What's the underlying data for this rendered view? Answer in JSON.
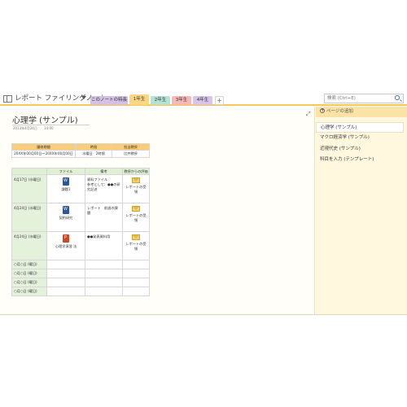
{
  "window": {
    "notebook_title": "レポート ファイリングノート"
  },
  "tabs": [
    {
      "label": "このノートの特長",
      "color": "#d5c0e6"
    },
    {
      "label": "1年生",
      "color": "#fbd784"
    },
    {
      "label": "2年生",
      "color": "#b4e3d6"
    },
    {
      "label": "3年生",
      "color": "#f7b9b6"
    },
    {
      "label": "4年生",
      "color": "#d8c3ea"
    },
    {
      "label": "+",
      "color": "#fafafa"
    }
  ],
  "search": {
    "placeholder": "検索 (Ctrl+E)"
  },
  "page": {
    "title": "心理学 (サンプル)",
    "date": "2013年4月24日",
    "time": "14:00",
    "info_table": {
      "headers": [
        "履修期間",
        "時限",
        "担当教授"
      ],
      "row": [
        "20XX年00月00日〜20XX年00月00日",
        "水曜日　2時限",
        "比井教授"
      ]
    },
    "report_table": {
      "headers": [
        "",
        "ファイル",
        "備考",
        "教授からの評価"
      ],
      "rows": [
        {
          "date": "4月17日 (水曜日)",
          "file": "課題1",
          "file_icon": "word-doc-icon",
          "note": "資料ファイル\n参考として：●●の研究記述",
          "eval": "レポートの受領",
          "eval_icon": "mail-icon"
        },
        {
          "date": "4月24日 (水曜日)",
          "file": "契約研究",
          "file_icon": "word-doc-icon",
          "note": "レポート　前週の課題",
          "eval": "レポートの受領",
          "eval_icon": "mail-icon"
        },
        {
          "date": "4月24日 (水曜日)",
          "file": "心理学演習 法",
          "file_icon": "ppt-doc-icon",
          "note": "●●発表資料用",
          "eval": "レポートの受領",
          "eval_icon": "mail-icon"
        }
      ],
      "empty_rows": [
        "○月○日 (曜日)",
        "○月○日 (曜日)",
        "○月○日 (曜日)",
        "○月○日 (曜日)"
      ]
    }
  },
  "side_panel": {
    "add_page_label": "ページの追加",
    "pages": [
      "心理学 (サンプル)",
      "マクロ経済学 (サンプル)",
      "近現代史 (サンプル)",
      "科目を入力 (テンプレート)"
    ]
  }
}
